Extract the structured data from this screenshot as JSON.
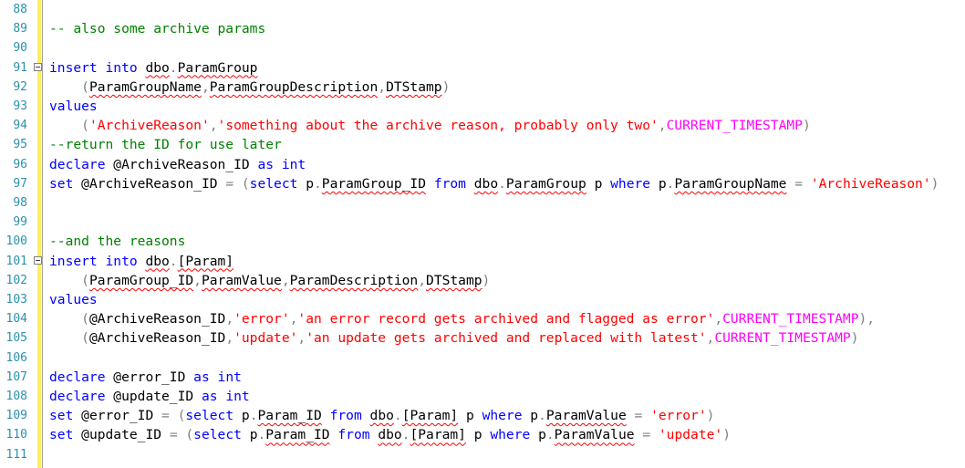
{
  "editor": {
    "lines": [
      {
        "num": "88",
        "fold": false,
        "tokens": []
      },
      {
        "num": "89",
        "fold": false,
        "tokens": [
          {
            "t": "-- also some archive params",
            "c": "cm"
          }
        ]
      },
      {
        "num": "90",
        "fold": false,
        "tokens": []
      },
      {
        "num": "91",
        "fold": true,
        "tokens": [
          {
            "t": "insert into ",
            "c": "kw"
          },
          {
            "t": "dbo",
            "c": "txt",
            "sq": true
          },
          {
            "t": ".",
            "c": "op"
          },
          {
            "t": "ParamGroup",
            "c": "txt",
            "sq": true
          }
        ]
      },
      {
        "num": "92",
        "fold": false,
        "tokens": [
          {
            "t": "    (",
            "c": "op"
          },
          {
            "t": "ParamGroupName",
            "c": "txt",
            "sq": true
          },
          {
            "t": ",",
            "c": "op"
          },
          {
            "t": "ParamGroupDescription",
            "c": "txt",
            "sq": true
          },
          {
            "t": ",",
            "c": "op"
          },
          {
            "t": "DTStamp",
            "c": "txt",
            "sq": true
          },
          {
            "t": ")",
            "c": "op"
          }
        ]
      },
      {
        "num": "93",
        "fold": false,
        "tokens": [
          {
            "t": "values",
            "c": "kw"
          }
        ]
      },
      {
        "num": "94",
        "fold": false,
        "tokens": [
          {
            "t": "    (",
            "c": "op"
          },
          {
            "t": "'ArchiveReason'",
            "c": "str"
          },
          {
            "t": ",",
            "c": "op"
          },
          {
            "t": "'something about the archive reason, probably only two'",
            "c": "str"
          },
          {
            "t": ",",
            "c": "op"
          },
          {
            "t": "CURRENT_TIMESTAMP",
            "c": "fn"
          },
          {
            "t": ")",
            "c": "op"
          }
        ]
      },
      {
        "num": "95",
        "fold": false,
        "tokens": [
          {
            "t": "--return the ID for use later",
            "c": "cm"
          }
        ]
      },
      {
        "num": "96",
        "fold": false,
        "tokens": [
          {
            "t": "declare ",
            "c": "kw"
          },
          {
            "t": "@ArchiveReason_ID ",
            "c": "txt"
          },
          {
            "t": "as ",
            "c": "kw"
          },
          {
            "t": "int",
            "c": "kw"
          }
        ]
      },
      {
        "num": "97",
        "fold": false,
        "tokens": [
          {
            "t": "set ",
            "c": "kw"
          },
          {
            "t": "@ArchiveReason_ID ",
            "c": "txt"
          },
          {
            "t": "= (",
            "c": "op"
          },
          {
            "t": "select ",
            "c": "kw"
          },
          {
            "t": "p",
            "c": "txt"
          },
          {
            "t": ".",
            "c": "op"
          },
          {
            "t": "ParamGroup_ID",
            "c": "txt",
            "sq": true
          },
          {
            "t": " ",
            "c": "txt"
          },
          {
            "t": "from ",
            "c": "kw"
          },
          {
            "t": "dbo",
            "c": "txt",
            "sq": true
          },
          {
            "t": ".",
            "c": "op"
          },
          {
            "t": "ParamGroup",
            "c": "txt",
            "sq": true
          },
          {
            "t": " p ",
            "c": "txt"
          },
          {
            "t": "where ",
            "c": "kw"
          },
          {
            "t": "p",
            "c": "txt"
          },
          {
            "t": ".",
            "c": "op"
          },
          {
            "t": "ParamGroupName",
            "c": "txt",
            "sq": true
          },
          {
            "t": " = ",
            "c": "op"
          },
          {
            "t": "'ArchiveReason'",
            "c": "str"
          },
          {
            "t": ")",
            "c": "op"
          }
        ]
      },
      {
        "num": "98",
        "fold": false,
        "tokens": []
      },
      {
        "num": "99",
        "fold": false,
        "tokens": []
      },
      {
        "num": "100",
        "fold": false,
        "tokens": [
          {
            "t": "--and the reasons",
            "c": "cm"
          }
        ]
      },
      {
        "num": "101",
        "fold": true,
        "tokens": [
          {
            "t": "insert into ",
            "c": "kw"
          },
          {
            "t": "dbo",
            "c": "txt",
            "sq": true
          },
          {
            "t": ".",
            "c": "op"
          },
          {
            "t": "[Param]",
            "c": "txt",
            "sq": true
          }
        ]
      },
      {
        "num": "102",
        "fold": false,
        "tokens": [
          {
            "t": "    (",
            "c": "op"
          },
          {
            "t": "ParamGroup_ID",
            "c": "txt",
            "sq": true
          },
          {
            "t": ",",
            "c": "op"
          },
          {
            "t": "ParamValue",
            "c": "txt",
            "sq": true
          },
          {
            "t": ",",
            "c": "op"
          },
          {
            "t": "ParamDescription",
            "c": "txt",
            "sq": true
          },
          {
            "t": ",",
            "c": "op"
          },
          {
            "t": "DTStamp",
            "c": "txt",
            "sq": true
          },
          {
            "t": ")",
            "c": "op"
          }
        ]
      },
      {
        "num": "103",
        "fold": false,
        "tokens": [
          {
            "t": "values",
            "c": "kw"
          }
        ]
      },
      {
        "num": "104",
        "fold": false,
        "tokens": [
          {
            "t": "    (",
            "c": "op"
          },
          {
            "t": "@ArchiveReason_ID",
            "c": "txt"
          },
          {
            "t": ",",
            "c": "op"
          },
          {
            "t": "'error'",
            "c": "str"
          },
          {
            "t": ",",
            "c": "op"
          },
          {
            "t": "'an error record gets archived and flagged as error'",
            "c": "str"
          },
          {
            "t": ",",
            "c": "op"
          },
          {
            "t": "CURRENT_TIMESTAMP",
            "c": "fn"
          },
          {
            "t": "),",
            "c": "op"
          }
        ]
      },
      {
        "num": "105",
        "fold": false,
        "tokens": [
          {
            "t": "    (",
            "c": "op"
          },
          {
            "t": "@ArchiveReason_ID",
            "c": "txt"
          },
          {
            "t": ",",
            "c": "op"
          },
          {
            "t": "'update'",
            "c": "str"
          },
          {
            "t": ",",
            "c": "op"
          },
          {
            "t": "'an update gets archived and replaced with latest'",
            "c": "str"
          },
          {
            "t": ",",
            "c": "op"
          },
          {
            "t": "CURRENT_TIMESTAMP",
            "c": "fn"
          },
          {
            "t": ")",
            "c": "op"
          }
        ]
      },
      {
        "num": "106",
        "fold": false,
        "tokens": []
      },
      {
        "num": "107",
        "fold": false,
        "tokens": [
          {
            "t": "declare ",
            "c": "kw"
          },
          {
            "t": "@error_ID ",
            "c": "txt"
          },
          {
            "t": "as ",
            "c": "kw"
          },
          {
            "t": "int",
            "c": "kw"
          }
        ]
      },
      {
        "num": "108",
        "fold": false,
        "tokens": [
          {
            "t": "declare ",
            "c": "kw"
          },
          {
            "t": "@update_ID ",
            "c": "txt"
          },
          {
            "t": "as ",
            "c": "kw"
          },
          {
            "t": "int",
            "c": "kw"
          }
        ]
      },
      {
        "num": "109",
        "fold": false,
        "tokens": [
          {
            "t": "set ",
            "c": "kw"
          },
          {
            "t": "@error_ID ",
            "c": "txt"
          },
          {
            "t": "= (",
            "c": "op"
          },
          {
            "t": "select ",
            "c": "kw"
          },
          {
            "t": "p",
            "c": "txt"
          },
          {
            "t": ".",
            "c": "op"
          },
          {
            "t": "Param_ID",
            "c": "txt",
            "sq": true
          },
          {
            "t": " ",
            "c": "txt"
          },
          {
            "t": "from ",
            "c": "kw"
          },
          {
            "t": "dbo",
            "c": "txt",
            "sq": true
          },
          {
            "t": ".",
            "c": "op"
          },
          {
            "t": "[Param]",
            "c": "txt",
            "sq": true
          },
          {
            "t": " p ",
            "c": "txt"
          },
          {
            "t": "where ",
            "c": "kw"
          },
          {
            "t": "p",
            "c": "txt"
          },
          {
            "t": ".",
            "c": "op"
          },
          {
            "t": "ParamValue",
            "c": "txt",
            "sq": true
          },
          {
            "t": " = ",
            "c": "op"
          },
          {
            "t": "'error'",
            "c": "str"
          },
          {
            "t": ")",
            "c": "op"
          }
        ]
      },
      {
        "num": "110",
        "fold": false,
        "tokens": [
          {
            "t": "set ",
            "c": "kw"
          },
          {
            "t": "@update_ID ",
            "c": "txt"
          },
          {
            "t": "= (",
            "c": "op"
          },
          {
            "t": "select ",
            "c": "kw"
          },
          {
            "t": "p",
            "c": "txt"
          },
          {
            "t": ".",
            "c": "op"
          },
          {
            "t": "Param_ID",
            "c": "txt",
            "sq": true
          },
          {
            "t": " ",
            "c": "txt"
          },
          {
            "t": "from ",
            "c": "kw"
          },
          {
            "t": "dbo",
            "c": "txt",
            "sq": true
          },
          {
            "t": ".",
            "c": "op"
          },
          {
            "t": "[Param]",
            "c": "txt",
            "sq": true
          },
          {
            "t": " p ",
            "c": "txt"
          },
          {
            "t": "where ",
            "c": "kw"
          },
          {
            "t": "p",
            "c": "txt"
          },
          {
            "t": ".",
            "c": "op"
          },
          {
            "t": "ParamValue",
            "c": "txt",
            "sq": true
          },
          {
            "t": " = ",
            "c": "op"
          },
          {
            "t": "'update'",
            "c": "str"
          },
          {
            "t": ")",
            "c": "op"
          }
        ]
      },
      {
        "num": "111",
        "fold": false,
        "tokens": []
      }
    ]
  }
}
